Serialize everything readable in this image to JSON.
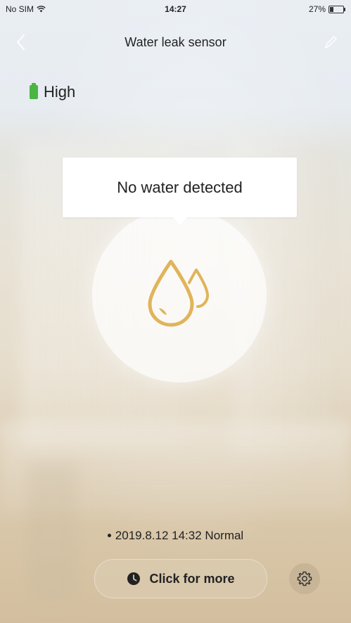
{
  "status_bar": {
    "carrier": "No SIM",
    "time": "14:27",
    "battery": "27%",
    "battery_level": 0.27,
    "icons": [
      "wifi-icon",
      "battery-icon"
    ]
  },
  "nav": {
    "title": "Water leak sensor",
    "back_icon": "chevron-left-icon",
    "edit_icon": "pencil-icon"
  },
  "device_battery": {
    "label": "High",
    "icon": "battery-icon",
    "color": "#4bb543"
  },
  "status": {
    "message": "No water detected",
    "icon": "water-drops-icon",
    "icon_color": "#e0b45a"
  },
  "record": {
    "timestamp": "2019.8.12 14:32",
    "state": "Normal"
  },
  "actions": {
    "more_label": "Click for more",
    "more_icon": "clock-icon",
    "settings_icon": "gear-icon"
  }
}
